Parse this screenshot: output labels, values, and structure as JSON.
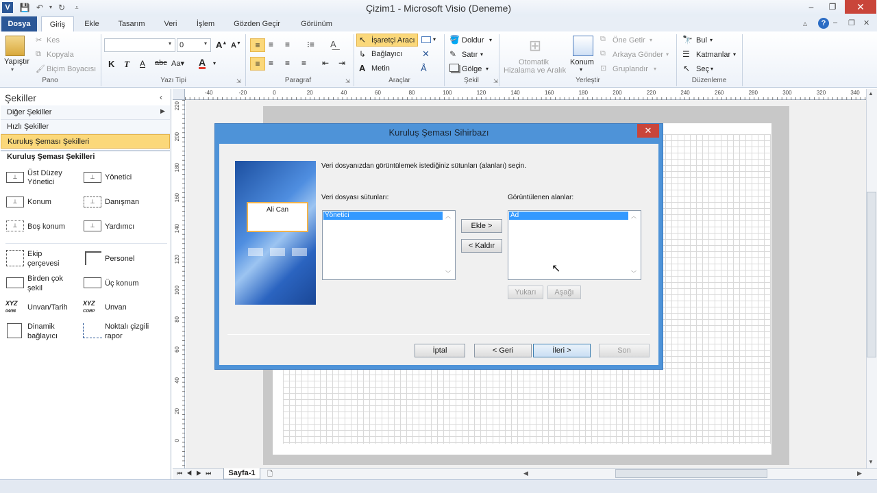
{
  "window": {
    "title": "Çizim1 - Microsoft Visio (Deneme)",
    "quick_access": [
      "visio-logo-icon",
      "save-icon",
      "undo-icon",
      "redo-icon",
      "customize-icon"
    ],
    "controls": {
      "minimize": "–",
      "restore": "❐",
      "close": "✕"
    }
  },
  "tabs": {
    "file": "Dosya",
    "home": "Giriş",
    "insert": "Ekle",
    "design": "Tasarım",
    "data": "Veri",
    "process": "İşlem",
    "review": "Gözden Geçir",
    "view": "Görünüm"
  },
  "ribbon": {
    "pano": {
      "label": "Pano",
      "paste": "Yapıştır",
      "cut": "Kes",
      "copy": "Kopyala",
      "format_painter": "Biçim Boyacısı"
    },
    "font": {
      "label": "Yazı Tipi",
      "font_name": "",
      "font_size": "0"
    },
    "paragraph": {
      "label": "Paragraf"
    },
    "tools": {
      "label": "Araçlar",
      "pointer": "İşaretçi Aracı",
      "connector": "Bağlayıcı",
      "text": "Metin"
    },
    "shape": {
      "label": "Şekil",
      "fill": "Doldur",
      "line": "Satır",
      "shadow": "Gölge"
    },
    "arrange": {
      "label": "Yerleştir",
      "auto_align_1": "Otomatik",
      "auto_align_2": "Hizalama ve Aralık",
      "position": "Konum",
      "bring_front": "Öne Getir",
      "send_back": "Arkaya Gönder",
      "group": "Gruplandır"
    },
    "editing": {
      "label": "Düzenleme",
      "find": "Bul",
      "layers": "Katmanlar",
      "select": "Seç"
    }
  },
  "shapes_panel": {
    "title": "Şekiller",
    "stencils": [
      "Diğer Şekiller",
      "Hızlı Şekiller",
      "Kuruluş Şeması Şekilleri"
    ],
    "active_stencil": "Kuruluş Şeması Şekilleri",
    "section_title": "Kuruluş Şeması Şekilleri",
    "shapes": [
      {
        "label1": "Üst Düzey",
        "label2": "Yönetici",
        "icon": "executive-shape-icon"
      },
      {
        "label1": "Yönetici",
        "label2": "",
        "icon": "manager-shape-icon"
      },
      {
        "label1": "Konum",
        "label2": "",
        "icon": "position-shape-icon"
      },
      {
        "label1": "Danışman",
        "label2": "",
        "icon": "consultant-shape-icon"
      },
      {
        "label1": "Boş konum",
        "label2": "",
        "icon": "vacancy-shape-icon"
      },
      {
        "label1": "Yardımcı",
        "label2": "",
        "icon": "assistant-shape-icon"
      },
      {
        "label1": "Ekip",
        "label2": "çerçevesi",
        "icon": "team-frame-icon"
      },
      {
        "label1": "Personel",
        "label2": "",
        "icon": "staff-shape-icon"
      },
      {
        "label1": "Birden çok",
        "label2": "şekil",
        "icon": "multiple-shapes-icon"
      },
      {
        "label1": "Üç konum",
        "label2": "",
        "icon": "three-positions-icon"
      },
      {
        "label1": "Unvan/Tarih",
        "label2": "",
        "icon": "title-date-icon"
      },
      {
        "label1": "Unvan",
        "label2": "",
        "icon": "title-icon"
      },
      {
        "label1": "Dinamik",
        "label2": "bağlayıcı",
        "icon": "dynamic-connector-icon"
      },
      {
        "label1": "Noktalı çizgili",
        "label2": "rapor",
        "icon": "dotted-line-report-icon"
      }
    ]
  },
  "rulers": {
    "h": [
      "-40",
      "-20",
      "0",
      "20",
      "40",
      "60",
      "80",
      "100",
      "120",
      "140",
      "160",
      "180",
      "200",
      "220",
      "240",
      "260",
      "280",
      "300",
      "320",
      "340"
    ],
    "v": [
      "220",
      "200",
      "180",
      "160",
      "140",
      "120",
      "100",
      "80",
      "60",
      "40",
      "20",
      "0"
    ]
  },
  "page_tab": "Sayfa-1",
  "dialog": {
    "title": "Kuruluş Şeması Sihirbazı",
    "instruction": "Veri dosyanızdan görüntülemek istediğiniz sütunları (alanları) seçin.",
    "preview_box_text": "Ali Can",
    "left_list_label": "Veri dosyası sütunları:",
    "left_list_items": [
      "Yönetici"
    ],
    "right_list_label": "Görüntülenen alanlar:",
    "right_list_items": [
      "Ad"
    ],
    "add_button": "Ekle >",
    "remove_button": "< Kaldır",
    "up_button": "Yukarı",
    "down_button": "Aşağı",
    "cancel_button": "İptal",
    "back_button": "< Geri",
    "next_button": "İleri >",
    "finish_button": "Son"
  }
}
